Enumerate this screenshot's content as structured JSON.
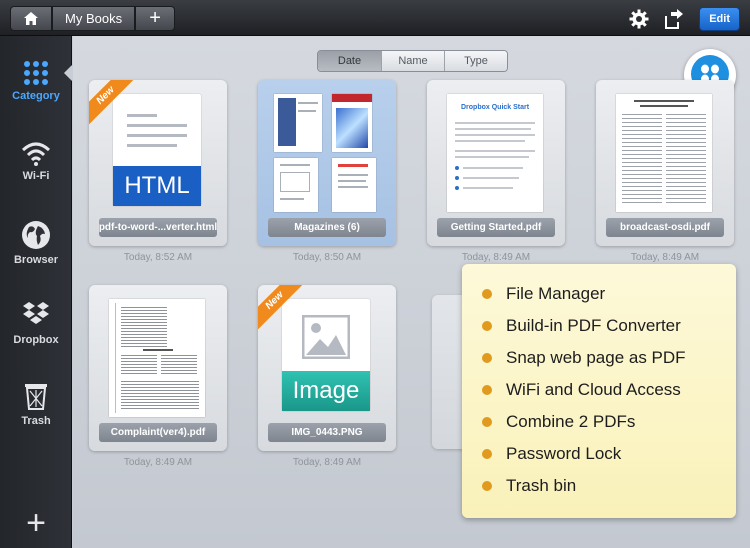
{
  "topbar": {
    "home_icon": "home-icon",
    "title": "My Books",
    "add_label": "+",
    "settings_icon": "gear-icon",
    "share_icon": "export-icon",
    "edit_label": "Edit"
  },
  "sidebar": {
    "items": [
      {
        "label": "Category",
        "icon": "grid-icon",
        "active": true
      },
      {
        "label": "Wi-Fi",
        "icon": "wifi-icon"
      },
      {
        "label": "Browser",
        "icon": "globe-icon"
      },
      {
        "label": "Dropbox",
        "icon": "dropbox-icon"
      },
      {
        "label": "Trash",
        "icon": "trash-icon"
      }
    ],
    "add_label": "+"
  },
  "sort": {
    "options": [
      "Date",
      "Name",
      "Type"
    ],
    "selected": "Date"
  },
  "files": [
    {
      "name": "pdf-to-word-...verter.html",
      "time": "Today, 8:52 AM",
      "type_label": "HTML",
      "new_label": "New"
    },
    {
      "name": "Magazines (6)",
      "time": "Today, 8:50 AM"
    },
    {
      "name": "Getting Started.pdf",
      "time": "Today, 8:49 AM",
      "doc_title": "Dropbox Quick Start"
    },
    {
      "name": "broadcast-osdi.pdf",
      "time": "Today, 8:49 AM"
    },
    {
      "name": "Complaint(ver4).pdf",
      "time": "Today, 8:49 AM"
    },
    {
      "name": "IMG_0443.PNG",
      "time": "Today, 8:49 AM",
      "type_label": "Image",
      "new_label": "New"
    }
  ],
  "features": [
    "File Manager",
    "Build-in PDF Converter",
    "Snap web page as PDF",
    "WiFi and Cloud Access",
    "Combine 2 PDFs",
    "Password Lock",
    "Trash bin"
  ],
  "colors": {
    "accent": "#3b8ff0",
    "new_badge": "#f08a1c",
    "html_badge": "#1a5fc4",
    "image_badge": "#21a89a",
    "feature_dot": "#e09a1d"
  }
}
